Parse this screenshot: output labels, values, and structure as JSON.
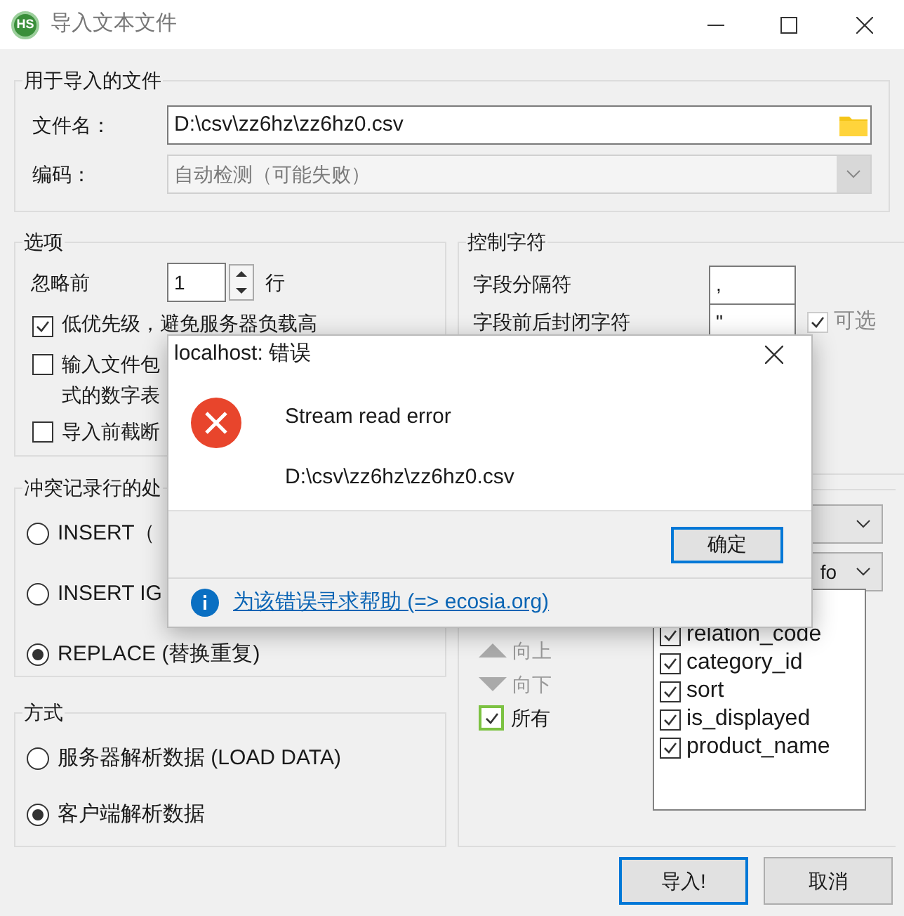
{
  "window": {
    "icon_label": "HS",
    "title": "导入文本文件"
  },
  "file_group": {
    "title": "用于导入的文件",
    "filename_label": "文件名：",
    "filename_value": "D:\\csv\\zz6hz\\zz6hz0.csv",
    "encoding_label": "编码：",
    "encoding_value": "自动检测（可能失败）",
    "encoding_disabled": true
  },
  "options": {
    "title": "选项",
    "skip_label": "忽略前",
    "skip_value": "1",
    "skip_unit": "行",
    "checks": [
      {
        "lines": [
          "低优先级，避免服务器负载高"
        ],
        "checked": true
      },
      {
        "lines": [
          "输入文件包",
          "式的数字表"
        ],
        "checked": false
      },
      {
        "lines": [
          "导入前截断"
        ],
        "checked": false
      }
    ]
  },
  "control_chars": {
    "title": "控制字符",
    "fields": [
      {
        "label": "字段分隔符",
        "value": ","
      },
      {
        "label": "字段前后封闭字符",
        "value": "\"",
        "optional": {
          "label": "可选",
          "checked": true
        }
      }
    ]
  },
  "conflict": {
    "title": "冲突记录行的处",
    "options": [
      {
        "label": "INSERT（",
        "selected": false
      },
      {
        "label": "INSERT IG",
        "selected": false
      },
      {
        "label": "REPLACE (替换重复)",
        "selected": true
      }
    ]
  },
  "method": {
    "title": "方式",
    "options": [
      {
        "label": "服务器解析数据 (LOAD DATA)",
        "selected": false
      },
      {
        "label": "客户端解析数据",
        "selected": true
      }
    ]
  },
  "columns": {
    "dropdown_2_value": "fo",
    "up": "向上",
    "down": "向下",
    "all": {
      "label": "所有",
      "checked": true
    },
    "items": [
      {
        "label": "relation_code",
        "checked": true
      },
      {
        "label": "category_id",
        "checked": true
      },
      {
        "label": "sort",
        "checked": true
      },
      {
        "label": "is_displayed",
        "checked": true
      },
      {
        "label": "product_name",
        "checked": true
      }
    ]
  },
  "buttons": [
    {
      "label": "导入!",
      "default": true
    },
    {
      "label": "取消",
      "default": false
    }
  ],
  "dialog": {
    "title": "localhost: 错误",
    "message": "Stream read error",
    "detail": "D:\\csv\\zz6hz\\zz6hz0.csv",
    "ok": "确定",
    "help_link": "为该错误寻求帮助 (=> ecosia.org)"
  }
}
